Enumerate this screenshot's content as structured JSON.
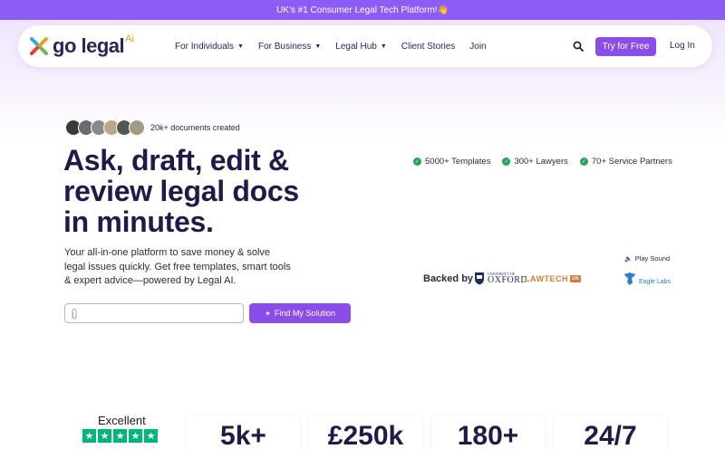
{
  "banner": {
    "text": "UK's #1 Consumer Legal Tech Platform!👋"
  },
  "logo": {
    "text": "go legal",
    "suffix": "Ai"
  },
  "nav": {
    "items": [
      {
        "label": "For Individuals",
        "dropdown": true
      },
      {
        "label": "For Business",
        "dropdown": true
      },
      {
        "label": "Legal Hub",
        "dropdown": true
      },
      {
        "label": "Client Stories",
        "dropdown": false
      },
      {
        "label": "Join",
        "dropdown": false
      }
    ],
    "try_label": "Try for Free",
    "login_label": "Log In"
  },
  "hero": {
    "social_proof": "20k+ documents created",
    "headline": "Ask, draft, edit & review legal docs in minutes.",
    "subtext": "Your all-in-one platform to save money & solve legal issues quickly. Get free templates, smart tools & expert advice—powered by Legal AI.",
    "input_placeholder": "",
    "find_label": "Find My Solution"
  },
  "stats_inline": [
    {
      "label": "5000+ Templates"
    },
    {
      "label": "300+ Lawyers"
    },
    {
      "label": "70+ Service Partners"
    }
  ],
  "backers": {
    "play_sound": "Play Sound",
    "backed_by": "Backed by",
    "oxford_small": "UNIVERSITY OF",
    "oxford_big": "OXFORD",
    "lawtech": "LAWTECH",
    "lawtech_tag": "UK",
    "eagle": "Eagle Labs"
  },
  "trust": {
    "rating_word": "Excellent",
    "stars": 5
  },
  "stat_cards": [
    {
      "value": "5k+"
    },
    {
      "value": "£250k"
    },
    {
      "value": "180+"
    },
    {
      "value": "24/7"
    }
  ],
  "colors": {
    "accent": "#8b4dea",
    "banner": "#8b5cf6",
    "heading": "#1e1b4b",
    "check": "#22a55a",
    "trustpilot": "#00b67a"
  }
}
